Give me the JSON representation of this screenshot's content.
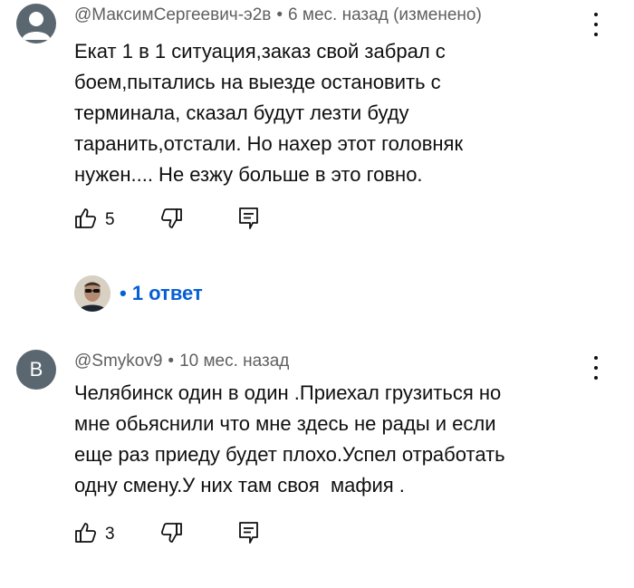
{
  "comments": [
    {
      "author": "@МаксимСергеевич-э2в",
      "time": "6 мес. назад (изменено)",
      "text": "Екат 1 в 1 ситуация,заказ свой забрал с\nбоем,пытались на выезде остановить с\nтерминала, сказал будут лезти буду\nтаранить,отстали. Но нахер этот головняк\nнужен.... Не езжу больше в это говно.",
      "likes": "5",
      "avatar_icon": "default-user-icon",
      "replies_label": "• 1 ответ"
    },
    {
      "author": "@Smykov9",
      "time": "10 мес. назад",
      "avatar_letter": "B",
      "text": "Челябинск один в один .Приехал грузиться но\nмне обьяснили что мне здесь не рады и если\nеще раз приеду будет плохо.Успел отработать\nодну смену.У них там своя  мафия .",
      "likes": "3"
    }
  ],
  "separator": "•",
  "colors": {
    "accent": "#065fd4",
    "avatar_bg": "#5b6770",
    "meta_text": "#606060"
  }
}
